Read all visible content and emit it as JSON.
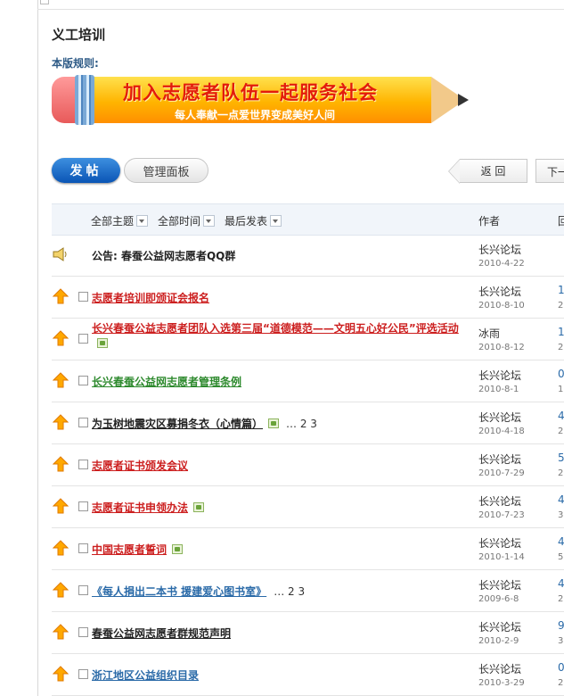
{
  "page": {
    "title": "义工培训",
    "rules_label": "本版规则:"
  },
  "banner": {
    "main_slogan": "加入志愿者队伍一起服务社会",
    "sub_slogan": "每人奉献一点爱世界变成美好人间"
  },
  "toolbar": {
    "post_label": "发帖",
    "manage_label": "管理面板",
    "back_label": "返 回",
    "next_label": "下一"
  },
  "thead": {
    "filter_topic": "全部主题",
    "filter_time": "全部时间",
    "filter_latest": "最后发表",
    "col_author": "作者",
    "col_reply": "回"
  },
  "rows": [
    {
      "type": "announcement",
      "title": "公告: 春蚕公益网志愿者QQ群",
      "color": "#222222",
      "author": "长兴论坛",
      "date": "2010-4-22",
      "reply": "",
      "views": ""
    },
    {
      "type": "topic",
      "title": "志愿者培训即颁证会报名",
      "color": "#cc1f1f",
      "author": "长兴论坛",
      "date": "2010-8-10",
      "reply": "1",
      "views": "2"
    },
    {
      "type": "topic",
      "title": "长兴春蚕公益志愿者团队入选第三届“道德模范——文明五心好公民”评选活动",
      "color": "#cc1f1f",
      "has_image": true,
      "author": "冰雨",
      "date": "2010-8-12",
      "reply": "1",
      "views": "2"
    },
    {
      "type": "topic",
      "title": "长兴春蚕公益网志愿者管理条例",
      "color": "#2e8a2e",
      "author": "长兴论坛",
      "date": "2010-8-1",
      "reply": "0",
      "views": "1"
    },
    {
      "type": "topic",
      "title": "为玉树地震灾区募捐冬衣（心情篇）",
      "color": "#222222",
      "has_image": true,
      "pages": "… 2  3",
      "author": "长兴论坛",
      "date": "2010-4-18",
      "reply": "4",
      "views": "2"
    },
    {
      "type": "topic",
      "title": "志愿者证书颁发会议",
      "color": "#cc1f1f",
      "author": "长兴论坛",
      "date": "2010-7-29",
      "reply": "5",
      "views": "2"
    },
    {
      "type": "topic",
      "title": "志愿者证书申领办法",
      "color": "#cc1f1f",
      "has_image": true,
      "author": "长兴论坛",
      "date": "2010-7-23",
      "reply": "4",
      "views": "3"
    },
    {
      "type": "topic",
      "title": "中国志愿者誓词",
      "color": "#cc1f1f",
      "has_image": true,
      "author": "长兴论坛",
      "date": "2010-1-14",
      "reply": "4",
      "views": "5"
    },
    {
      "type": "topic",
      "title": "《每人捐出二本书 援建爱心图书室》",
      "color": "#2a6aa8",
      "pages": "… 2  3",
      "author": "长兴论坛",
      "date": "2009-6-8",
      "reply": "4",
      "views": "2"
    },
    {
      "type": "topic",
      "title": "春蚕公益网志愿者群规范声明",
      "color": "#222222",
      "author": "长兴论坛",
      "date": "2010-2-9",
      "reply": "9",
      "views": "3"
    },
    {
      "type": "topic",
      "title": "浙江地区公益组织目录",
      "color": "#2a6aa8",
      "author": "长兴论坛",
      "date": "2010-3-29",
      "reply": "0",
      "views": "2"
    }
  ],
  "icons": {
    "sticky": "arrow-up-icon",
    "announcement": "megaphone-icon",
    "image": "image-attachment-icon"
  }
}
